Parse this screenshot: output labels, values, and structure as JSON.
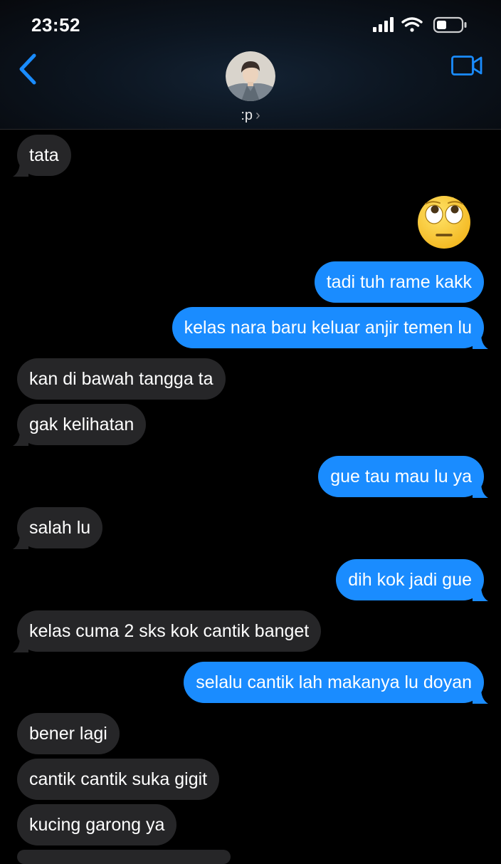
{
  "status_bar": {
    "time": "23:52"
  },
  "header": {
    "contact_name": ":p",
    "chevron": "›"
  },
  "icons": {
    "back": "chevron-left-icon",
    "video": "video-camera-icon",
    "signal": "signal-bars-icon",
    "wifi": "wifi-icon",
    "battery": "battery-icon"
  },
  "colors": {
    "accent": "#1a8cff",
    "incoming_bubble": "#262628",
    "background": "#000000"
  },
  "messages": [
    {
      "dir": "in",
      "text": "tata"
    },
    {
      "dir": "out",
      "emoji": "face-with-rolling-eyes"
    },
    {
      "dir": "out",
      "text": "tadi tuh rame kakk"
    },
    {
      "dir": "out",
      "text": "kelas nara baru keluar anjir temen lu"
    },
    {
      "dir": "in",
      "text": "kan di bawah tangga ta"
    },
    {
      "dir": "in",
      "text": "gak kelihatan"
    },
    {
      "dir": "out",
      "text": "gue tau mau lu ya"
    },
    {
      "dir": "in",
      "text": "salah lu"
    },
    {
      "dir": "out",
      "text": "dih kok jadi gue"
    },
    {
      "dir": "in",
      "text": "kelas cuma 2 sks kok cantik banget"
    },
    {
      "dir": "out",
      "text": "selalu cantik lah makanya lu doyan"
    },
    {
      "dir": "in",
      "text": "bener lagi"
    },
    {
      "dir": "in",
      "text": "cantik cantik suka gigit"
    },
    {
      "dir": "in",
      "text": "kucing garong ya"
    }
  ]
}
